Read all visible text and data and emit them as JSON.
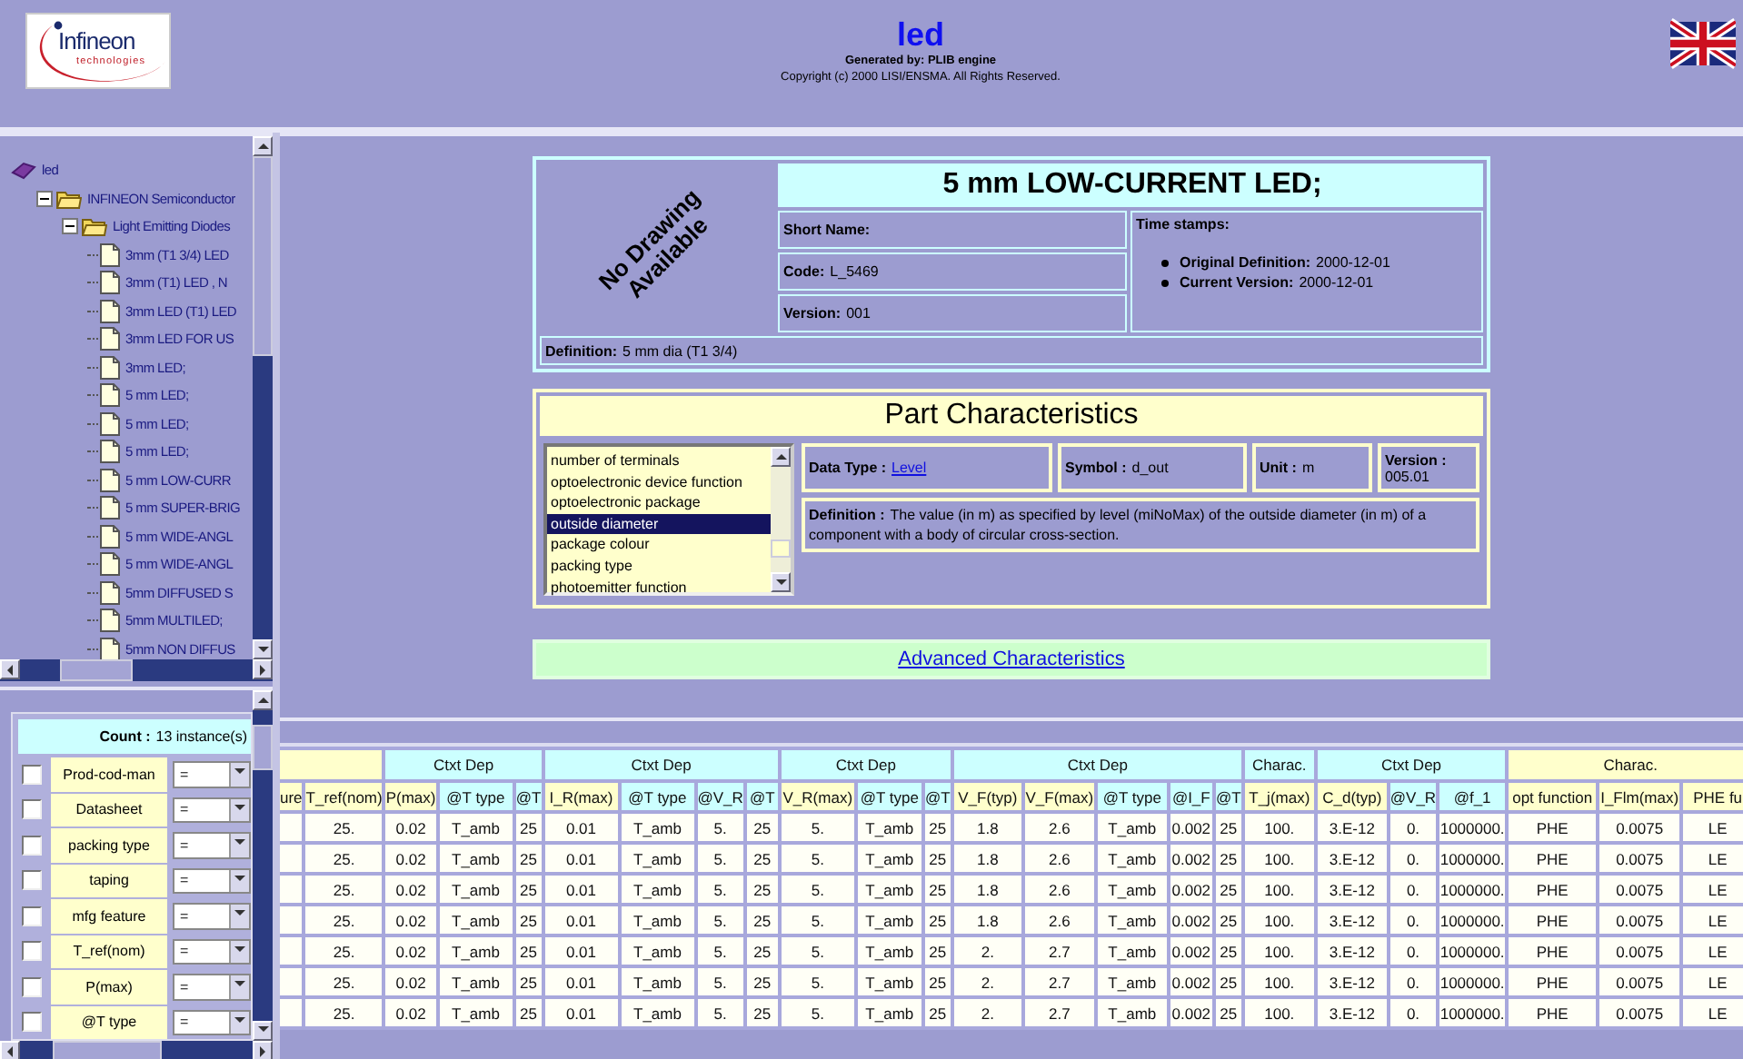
{
  "header": {
    "logo": {
      "name": "Infineon",
      "tagline": "technologies"
    },
    "title": "led",
    "generator": "Generated by: PLIB engine",
    "copyright": "Copyright (c) 2000 LISI/ENSMA. All Rights Reserved."
  },
  "tree": {
    "label": "led",
    "kind": "root",
    "children": [
      {
        "label": "INFINEON Semiconductor",
        "kind": "folder",
        "expanded": true,
        "children": [
          {
            "label": "Light Emitting Diodes",
            "kind": "folder",
            "expanded": true,
            "children": [
              {
                "label": "3mm (T1 3/4) LED",
                "kind": "leaf"
              },
              {
                "label": "3mm (T1) LED , N",
                "kind": "leaf"
              },
              {
                "label": "3mm LED (T1) LED",
                "kind": "leaf"
              },
              {
                "label": "3mm LED FOR US",
                "kind": "leaf"
              },
              {
                "label": "3mm LED;",
                "kind": "leaf"
              },
              {
                "label": "5 mm LED;",
                "kind": "leaf"
              },
              {
                "label": "5 mm LED;",
                "kind": "leaf"
              },
              {
                "label": "5 mm LED;",
                "kind": "leaf"
              },
              {
                "label": "5 mm LOW-CURR",
                "kind": "leaf"
              },
              {
                "label": "5 mm SUPER-BRIG",
                "kind": "leaf"
              },
              {
                "label": "5 mm WIDE-ANGL",
                "kind": "leaf"
              },
              {
                "label": "5 mm WIDE-ANGL",
                "kind": "leaf"
              },
              {
                "label": "5mm DIFFUSED S",
                "kind": "leaf"
              },
              {
                "label": "5mm MULTILED;",
                "kind": "leaf"
              },
              {
                "label": "5mm NON DIFFUS",
                "kind": "leaf"
              }
            ]
          }
        ]
      }
    ]
  },
  "filter": {
    "count": {
      "label": "Count :",
      "value": "13 instance(s)"
    },
    "rows": [
      {
        "label": "Prod-cod-man",
        "checked": false,
        "operator": "="
      },
      {
        "label": "Datasheet",
        "checked": false,
        "operator": "="
      },
      {
        "label": "packing type",
        "checked": false,
        "operator": "="
      },
      {
        "label": "taping",
        "checked": false,
        "operator": "="
      },
      {
        "label": "mfg feature",
        "checked": false,
        "operator": "="
      },
      {
        "label": "T_ref(nom)",
        "checked": false,
        "operator": "="
      },
      {
        "label": "P(max)",
        "checked": false,
        "operator": "="
      },
      {
        "label": "@T type",
        "checked": false,
        "operator": "="
      }
    ]
  },
  "part": {
    "drawing": "No Drawing Available",
    "name": "5 mm LOW-CURRENT LED;",
    "fields": [
      {
        "label": "Short Name:"
      },
      {
        "label": "Code:",
        "value": "L_5469"
      },
      {
        "label": "Version:",
        "value": "001"
      }
    ],
    "timestamps": {
      "label": "Time stamps:",
      "items": [
        {
          "label": "Original Definition:",
          "value": "2000-12-01"
        },
        {
          "label": "Current Version:",
          "value": "2000-12-01"
        }
      ]
    },
    "definition": {
      "label": "Definition:",
      "value": "5 mm dia (T1 3/4)"
    }
  },
  "characteristics": {
    "title": "Part Characteristics",
    "list": [
      {
        "label": "number of terminals",
        "selected": false
      },
      {
        "label": "optoelectronic device function",
        "selected": false
      },
      {
        "label": "optoelectronic package",
        "selected": false
      },
      {
        "label": "outside diameter",
        "selected": true
      },
      {
        "label": "package colour",
        "selected": false
      },
      {
        "label": "packing type",
        "selected": false
      },
      {
        "label": "photoemitter function",
        "selected": false
      }
    ],
    "data_type": {
      "label": "Data Type :",
      "value": "Level"
    },
    "symbol": {
      "label": "Symbol :",
      "value": "d_out"
    },
    "unit": {
      "label": "Unit :",
      "value": "m"
    },
    "version": {
      "label": "Version :",
      "value": "005.01"
    },
    "definition": {
      "label": "Definition :",
      "value": "The value (in m) as specified by level (miNoMax) of the outside diameter (in m) of a component with a body of circular cross-section."
    }
  },
  "advanced": {
    "label": "Advanced Characteristics"
  },
  "table": {
    "groups": [
      {
        "kind": "charac",
        "columns": [
          {
            "label": "ure",
            "kind": "charac"
          },
          {
            "label": "T_ref(nom)",
            "kind": "charac"
          }
        ]
      },
      {
        "label": "Ctxt Dep",
        "kind": "context",
        "columns": [
          {
            "label": "P(max)",
            "kind": "charac"
          },
          {
            "label": "@T type",
            "kind": "context"
          },
          {
            "label": "@T",
            "kind": "context"
          }
        ]
      },
      {
        "label": "Ctxt Dep",
        "kind": "context",
        "columns": [
          {
            "label": "I_R(max)",
            "kind": "charac"
          },
          {
            "label": "@T type",
            "kind": "context"
          },
          {
            "label": "@V_R",
            "kind": "context"
          },
          {
            "label": "@T",
            "kind": "context"
          }
        ]
      },
      {
        "label": "Ctxt Dep",
        "kind": "context",
        "columns": [
          {
            "label": "V_R(max)",
            "kind": "charac"
          },
          {
            "label": "@T type",
            "kind": "context"
          },
          {
            "label": "@T",
            "kind": "context"
          }
        ]
      },
      {
        "label": "Ctxt Dep",
        "kind": "context",
        "columns": [
          {
            "label": "V_F(typ)",
            "kind": "charac"
          },
          {
            "label": "V_F(max)",
            "kind": "charac"
          },
          {
            "label": "@T type",
            "kind": "context"
          },
          {
            "label": "@I_F",
            "kind": "context"
          },
          {
            "label": "@T",
            "kind": "context"
          }
        ]
      },
      {
        "label": "Charac.",
        "kind": "context",
        "columns": [
          {
            "label": "T_j(max)",
            "kind": "charac"
          }
        ]
      },
      {
        "label": "Ctxt Dep",
        "kind": "context",
        "columns": [
          {
            "label": "C_d(typ)",
            "kind": "charac"
          },
          {
            "label": "@V_R",
            "kind": "context"
          },
          {
            "label": "@f_1",
            "kind": "context"
          }
        ]
      },
      {
        "label": "Charac.",
        "kind": "charac",
        "columns": [
          {
            "label": "opt function",
            "kind": "charac"
          },
          {
            "label": "I_Flm(max)",
            "kind": "charac"
          },
          {
            "label": "PHE fu",
            "kind": "charac"
          }
        ]
      }
    ],
    "rows": [
      [
        null,
        "25.",
        "0.02",
        "T_amb",
        "25",
        "0.01",
        "T_amb",
        "5.",
        "25",
        "5.",
        "T_amb",
        "25",
        "1.8",
        "2.6",
        "T_amb",
        "0.002",
        "25",
        "100.",
        "3.E-12",
        "0.",
        "1000000.",
        "PHE",
        "0.0075",
        "LE"
      ],
      [
        null,
        "25.",
        "0.02",
        "T_amb",
        "25",
        "0.01",
        "T_amb",
        "5.",
        "25",
        "5.",
        "T_amb",
        "25",
        "1.8",
        "2.6",
        "T_amb",
        "0.002",
        "25",
        "100.",
        "3.E-12",
        "0.",
        "1000000.",
        "PHE",
        "0.0075",
        "LE"
      ],
      [
        null,
        "25.",
        "0.02",
        "T_amb",
        "25",
        "0.01",
        "T_amb",
        "5.",
        "25",
        "5.",
        "T_amb",
        "25",
        "1.8",
        "2.6",
        "T_amb",
        "0.002",
        "25",
        "100.",
        "3.E-12",
        "0.",
        "1000000.",
        "PHE",
        "0.0075",
        "LE"
      ],
      [
        null,
        "25.",
        "0.02",
        "T_amb",
        "25",
        "0.01",
        "T_amb",
        "5.",
        "25",
        "5.",
        "T_amb",
        "25",
        "1.8",
        "2.6",
        "T_amb",
        "0.002",
        "25",
        "100.",
        "3.E-12",
        "0.",
        "1000000.",
        "PHE",
        "0.0075",
        "LE"
      ],
      [
        null,
        "25.",
        "0.02",
        "T_amb",
        "25",
        "0.01",
        "T_amb",
        "5.",
        "25",
        "5.",
        "T_amb",
        "25",
        "2.",
        "2.7",
        "T_amb",
        "0.002",
        "25",
        "100.",
        "3.E-12",
        "0.",
        "1000000.",
        "PHE",
        "0.0075",
        "LE"
      ],
      [
        null,
        "25.",
        "0.02",
        "T_amb",
        "25",
        "0.01",
        "T_amb",
        "5.",
        "25",
        "5.",
        "T_amb",
        "25",
        "2.",
        "2.7",
        "T_amb",
        "0.002",
        "25",
        "100.",
        "3.E-12",
        "0.",
        "1000000.",
        "PHE",
        "0.0075",
        "LE"
      ],
      [
        null,
        "25.",
        "0.02",
        "T_amb",
        "25",
        "0.01",
        "T_amb",
        "5.",
        "25",
        "5.",
        "T_amb",
        "25",
        "2.",
        "2.7",
        "T_amb",
        "0.002",
        "25",
        "100.",
        "3.E-12",
        "0.",
        "1000000.",
        "PHE",
        "0.0075",
        "LE"
      ]
    ]
  }
}
